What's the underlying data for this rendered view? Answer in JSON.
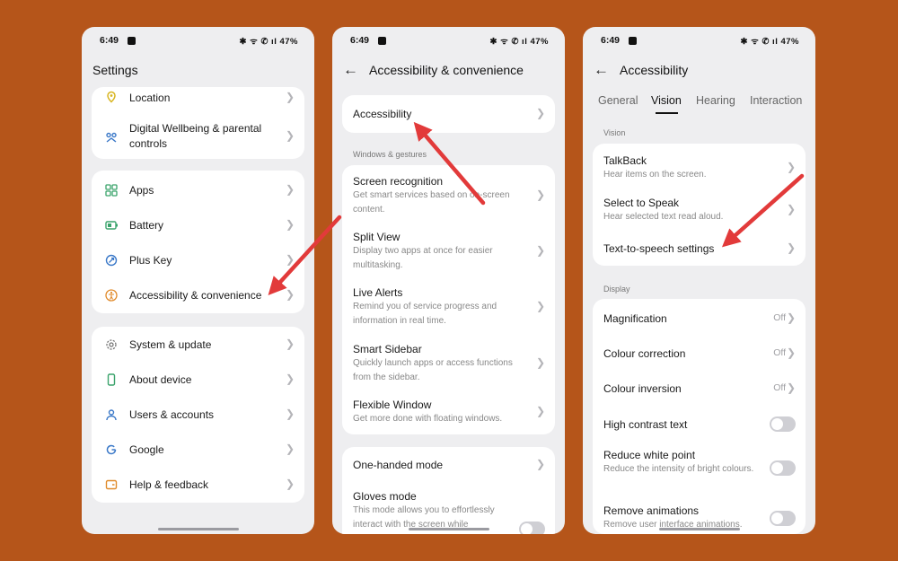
{
  "colors": {
    "background": "#b5551a",
    "arrow": "#e23a3a",
    "icon_green": "#3aa36b",
    "icon_yellow": "#d8b520",
    "icon_blue": "#3a78c8",
    "icon_orange": "#e08a2a"
  },
  "status": {
    "time": "6:49",
    "indicators": "✱ ᯤ ✆ ıl 47%"
  },
  "phone1": {
    "title": "Settings",
    "card1": [
      {
        "label": "Location",
        "icon": "location-pin-icon"
      },
      {
        "label": "Digital Wellbeing & parental controls",
        "icon": "wellbeing-icon"
      }
    ],
    "card2": [
      {
        "label": "Apps",
        "icon": "apps-grid-icon"
      },
      {
        "label": "Battery",
        "icon": "battery-icon"
      },
      {
        "label": "Plus Key",
        "icon": "plus-key-icon"
      },
      {
        "label": "Accessibility & convenience",
        "icon": "accessibility-icon"
      }
    ],
    "card3": [
      {
        "label": "System & update",
        "icon": "gear-icon"
      },
      {
        "label": "About device",
        "icon": "phone-icon"
      },
      {
        "label": "Users & accounts",
        "icon": "user-icon"
      },
      {
        "label": "Google",
        "icon": "google-icon"
      },
      {
        "label": "Help & feedback",
        "icon": "help-icon"
      }
    ]
  },
  "phone2": {
    "title": "Accessibility & convenience",
    "top_item": "Accessibility",
    "section": "Windows & gestures",
    "items": [
      {
        "title": "Screen recognition",
        "desc": "Get smart services based on on-screen content."
      },
      {
        "title": "Split View",
        "desc": "Display two apps at once for easier multitasking."
      },
      {
        "title": "Live Alerts",
        "desc": "Remind you of service progress and information in real time."
      },
      {
        "title": "Smart Sidebar",
        "desc": "Quickly launch apps or access functions from the sidebar."
      },
      {
        "title": "Flexible Window",
        "desc": "Get more done with floating windows."
      }
    ],
    "bottom": [
      {
        "title": "One-handed mode",
        "desc": ""
      },
      {
        "title": "Gloves mode",
        "desc": "This mode allows you to effortlessly interact with the screen while"
      }
    ]
  },
  "phone3": {
    "title": "Accessibility",
    "tabs": [
      "General",
      "Vision",
      "Hearing",
      "Interaction"
    ],
    "active_tab": "Vision",
    "section_vision": "Vision",
    "vision_items": [
      {
        "title": "TalkBack",
        "desc": "Hear items on the screen."
      },
      {
        "title": "Select to Speak",
        "desc": "Hear selected text read aloud."
      },
      {
        "title": "Text-to-speech settings",
        "desc": ""
      }
    ],
    "section_display": "Display",
    "display_items": [
      {
        "title": "Magnification",
        "desc": "",
        "value": "Off"
      },
      {
        "title": "Colour correction",
        "desc": "",
        "value": "Off"
      },
      {
        "title": "Colour inversion",
        "desc": "",
        "value": "Off"
      },
      {
        "title": "High contrast text",
        "desc": "",
        "toggle": false
      },
      {
        "title": "Reduce white point",
        "desc": "Reduce the intensity of bright colours.",
        "toggle": false
      },
      {
        "title": "Remove animations",
        "desc": "Remove user interface animations.",
        "toggle": false
      }
    ]
  }
}
